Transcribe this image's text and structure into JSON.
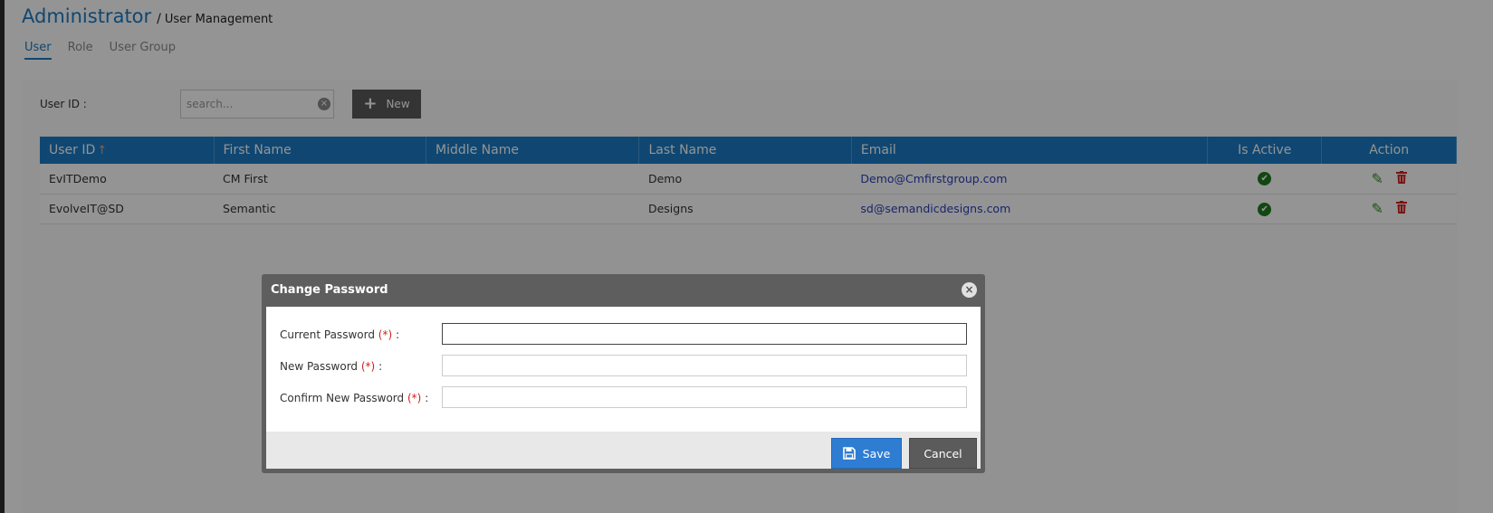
{
  "header": {
    "title": "Administrator",
    "separator": "/",
    "subtitle": "User Management"
  },
  "tabs": [
    {
      "label": "User",
      "active": true
    },
    {
      "label": "Role",
      "active": false
    },
    {
      "label": "User Group",
      "active": false
    }
  ],
  "filter": {
    "label": "User ID :",
    "search_placeholder": "search...",
    "clear_icon": "×",
    "new_button_label": "New"
  },
  "table": {
    "columns": [
      "User ID",
      "First Name",
      "Middle Name",
      "Last Name",
      "Email",
      "Is Active",
      "Action"
    ],
    "sort_indicator": "↑",
    "rows": [
      {
        "user_id": "EvITDemo",
        "first_name": "CM First",
        "middle_name": "",
        "last_name": "Demo",
        "email": "Demo@Cmfirstgroup.com",
        "is_active": true
      },
      {
        "user_id": "EvolveIT@SD",
        "first_name": "Semantic",
        "middle_name": "",
        "last_name": "Designs",
        "email": "sd@semandicdesigns.com",
        "is_active": true
      }
    ]
  },
  "dialog": {
    "title": "Change Password",
    "close_icon": "×",
    "fields": [
      {
        "label": "Current Password",
        "required_mark": "(*)",
        "suffix": ":",
        "value": ""
      },
      {
        "label": "New Password",
        "required_mark": "(*)",
        "suffix": ":",
        "value": ""
      },
      {
        "label": "Confirm New Password",
        "required_mark": "(*)",
        "suffix": ":",
        "value": ""
      }
    ],
    "save_label": "Save",
    "cancel_label": "Cancel"
  },
  "colors": {
    "accent": "#1a7ac4",
    "active_check": "#1f7a1f",
    "delete": "#d0211c",
    "edit": "#3a8a2a"
  },
  "icons": {
    "check": "check-circle-icon",
    "edit": "pencil-icon",
    "delete": "trash-icon",
    "save": "floppy-disk-icon",
    "new": "plus-icon"
  }
}
